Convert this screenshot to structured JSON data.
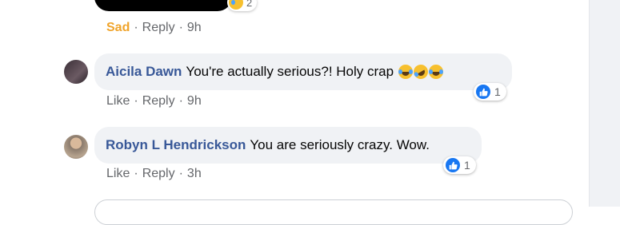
{
  "top_comment": {
    "sad_count": "2",
    "reaction_label": "Sad",
    "reply_label": "Reply",
    "time": "9h"
  },
  "comments": [
    {
      "author": "Aicila Dawn",
      "text": "You're actually serious?! Holy crap",
      "like_label": "Like",
      "reply_label": "Reply",
      "time": "9h",
      "reaction_count": "1"
    },
    {
      "author": "Robyn L Hendrickson",
      "text": "You are seriously crazy. Wow.",
      "like_label": "Like",
      "reply_label": "Reply",
      "time": "3h",
      "reaction_count": "1"
    }
  ],
  "separator": "·",
  "icons": {
    "sad": "sad-reaction-icon",
    "laugh": "laughing-emoji-icon",
    "rofl": "rolling-laughing-emoji-icon",
    "like": "like-reaction-icon"
  },
  "colors": {
    "link": "#385898",
    "meta": "#65676b",
    "sad": "#f0a42b",
    "like_blue": "#1877f2",
    "bubble": "#f0f2f5"
  }
}
